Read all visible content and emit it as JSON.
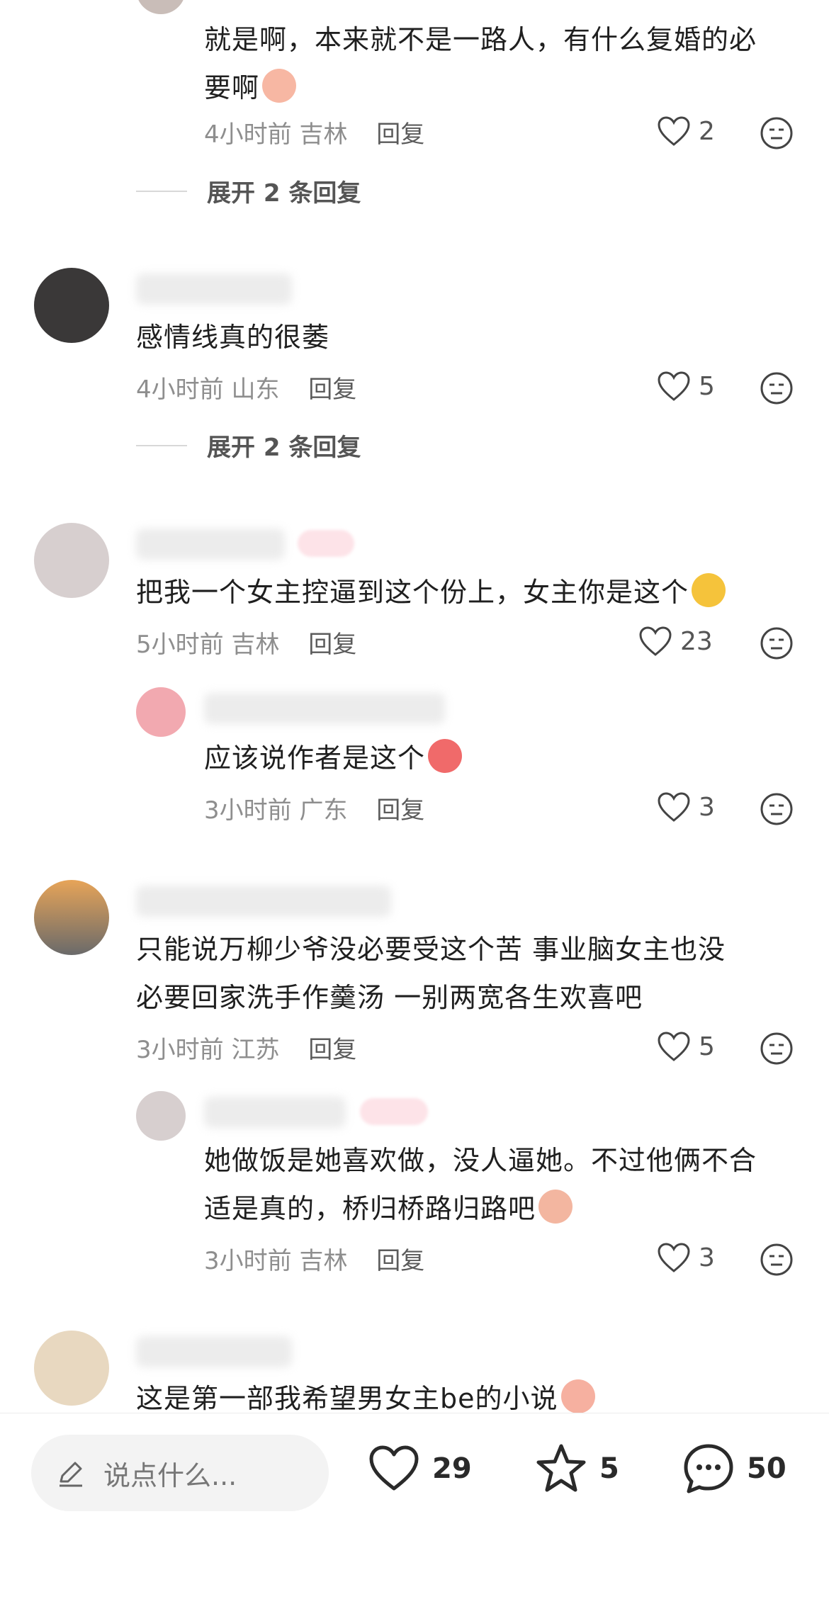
{
  "comments": [
    {
      "text_line1": "就是啊，本来就不是一路人，有什么复婚的必",
      "text_line2": "要啊",
      "time": "4小时前",
      "location": "吉林",
      "reply": "回复",
      "likes": "2",
      "expand": "展开 2 条回复"
    },
    {
      "text": "感情线真的很萎",
      "time": "4小时前",
      "location": "山东",
      "reply": "回复",
      "likes": "5",
      "expand": "展开 2 条回复"
    },
    {
      "text": "把我一个女主控逼到这个份上，女主你是这个",
      "time": "5小时前",
      "location": "吉林",
      "reply": "回复",
      "likes": "23",
      "subreply": {
        "text": "应该说作者是这个",
        "time": "3小时前",
        "location": "广东",
        "reply": "回复",
        "likes": "3"
      }
    },
    {
      "text_line1": "只能说万柳少爷没必要受这个苦   事业脑女主也没",
      "text_line2": "必要回家洗手作羹汤   一别两宽各生欢喜吧",
      "time": "3小时前",
      "location": "江苏",
      "reply": "回复",
      "likes": "5",
      "subreply": {
        "text_line1": "她做饭是她喜欢做，没人逼她。不过他俩不合",
        "text_line2": "适是真的，桥归桥路归路吧",
        "time": "3小时前",
        "location": "吉林",
        "reply": "回复",
        "likes": "3"
      }
    },
    {
      "text": "这是第一部我希望男女主be的小说"
    }
  ],
  "bottom_bar": {
    "input_placeholder": "说点什么...",
    "like_count": "29",
    "favorite_count": "5",
    "comment_count": "50"
  },
  "colors": {
    "accent_pink": "#f24d6b",
    "text_primary": "#1f1f1f",
    "text_secondary": "#8e8e8e"
  }
}
